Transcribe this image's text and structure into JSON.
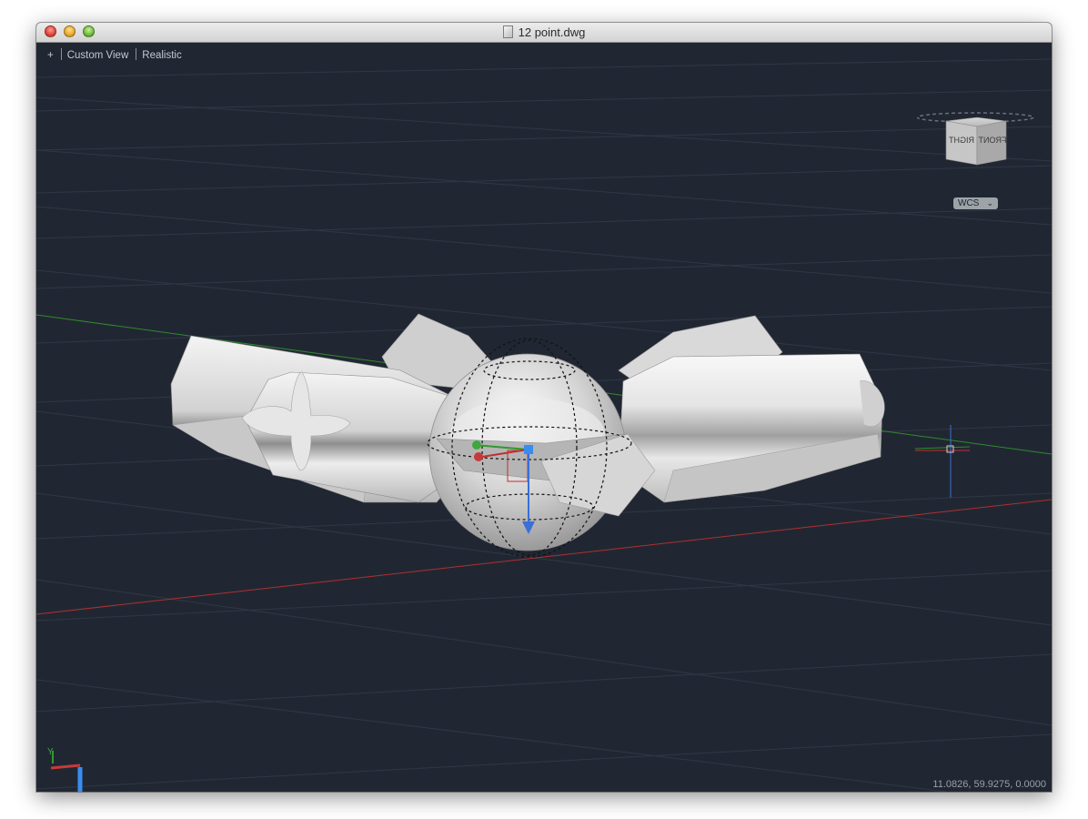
{
  "window": {
    "title": "12 point.dwg"
  },
  "viewport": {
    "controls": "+",
    "view": "Custom View",
    "style": "Realistic"
  },
  "viewcube": {
    "front_label": "FRONT",
    "right_label": "RIGHT"
  },
  "ucs_dropdown": {
    "label": "WCS",
    "chevron": "⌄"
  },
  "status": {
    "coordinates": "11.0826, 59.9275, 0.0000"
  },
  "icons": [
    "close-icon",
    "minimize-icon",
    "zoom-icon",
    "document-icon",
    "viewcube-icon",
    "ucs-icon",
    "crosshair-icon",
    "gizmo-icon"
  ],
  "colors": {
    "background": "#212732",
    "grid": "#2f3747",
    "x_axis": "#b03030",
    "y_axis": "#2f8a2f",
    "z_axis": "#3a6fd6"
  }
}
